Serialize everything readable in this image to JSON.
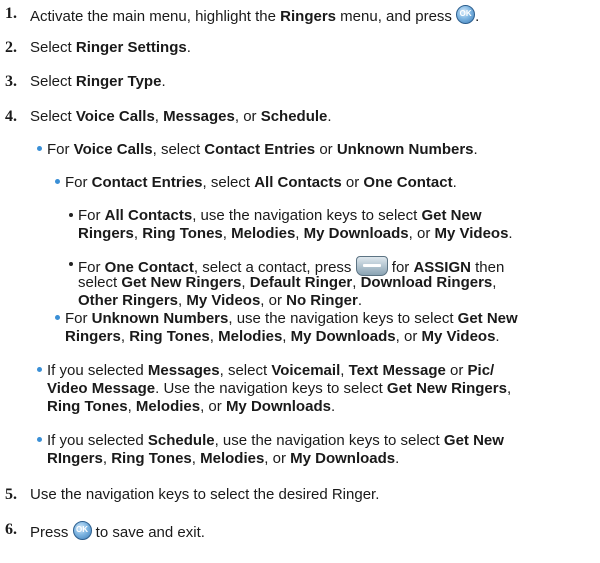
{
  "steps": [
    {
      "num": "1.",
      "parts": [
        "Activate the main menu, highlight the ",
        "Ringers",
        " menu, and press ",
        "."
      ]
    },
    {
      "num": "2.",
      "parts": [
        "Select ",
        "Ringer Settings",
        "."
      ]
    },
    {
      "num": "3.",
      "parts": [
        "Select ",
        "Ringer Type",
        "."
      ]
    },
    {
      "num": "4.",
      "parts": [
        "Select ",
        "Voice Calls",
        ", ",
        "Messages",
        ", or ",
        "Schedule",
        "."
      ]
    },
    {
      "num": "5.",
      "parts": [
        "Use the navigation keys to select the desired Ringer."
      ]
    },
    {
      "num": "6.",
      "parts": [
        "Press ",
        " to save and exit."
      ]
    }
  ],
  "voice_calls": {
    "parts": [
      "For ",
      "Voice Calls",
      ", select ",
      "Contact Entries",
      " or ",
      "Unknown Numbers",
      "."
    ]
  },
  "contact_entries": {
    "parts": [
      "For ",
      "Contact Entries",
      ", select ",
      "All Contacts",
      " or ",
      "One Contact",
      "."
    ]
  },
  "all_contacts": {
    "line1": [
      "For ",
      "All Contacts",
      ", use the navigation keys to select ",
      "Get New"
    ],
    "line2": [
      "Ringers",
      ", ",
      "Ring Tones",
      ", ",
      "Melodies",
      ", ",
      "My Downloads",
      ", or ",
      "My Videos",
      "."
    ]
  },
  "one_contact": {
    "line1": [
      "For ",
      "One Contact",
      ", select a contact, press ",
      " for ",
      "ASSIGN",
      " then"
    ],
    "line2": [
      "select ",
      "Get New Ringers",
      ", ",
      "Default Ringer",
      ", ",
      "Download Ringers",
      ","
    ],
    "line3": [
      "Other Ringers",
      ", ",
      "My Videos",
      ", or ",
      "No Ringer",
      "."
    ]
  },
  "unknown_numbers": {
    "line1": [
      "For ",
      "Unknown Numbers",
      ", use the navigation keys to select ",
      "Get New"
    ],
    "line2": [
      "Ringers",
      ", ",
      "Ring Tones",
      ", ",
      "Melodies",
      ", ",
      "My Downloads",
      ", or ",
      "My Videos",
      "."
    ]
  },
  "messages": {
    "line1": [
      "If you selected ",
      "Messages",
      ", select ",
      "Voicemail",
      ", ",
      "Text Message",
      " or ",
      "Pic/"
    ],
    "line2": [
      "Video Message",
      ". Use the navigation keys to select ",
      "Get New Ringers",
      ","
    ],
    "line3": [
      "Ring Tones",
      ", ",
      "Melodies",
      ", or ",
      "My Downloads",
      "."
    ]
  },
  "schedule": {
    "line1": [
      "If you selected ",
      "Schedule",
      ", use the navigation keys to select ",
      "Get New"
    ],
    "line2": [
      "RIngers",
      ", ",
      "Ring Tones",
      ", ",
      "Melodies",
      ", or ",
      "My Downloads",
      "."
    ]
  },
  "icons": {
    "ok_label": "OK",
    "ok_icon": "ok-button-icon",
    "softkey_icon": "left-softkey-icon"
  },
  "colors": {
    "bullet": "#3a8fd6"
  }
}
